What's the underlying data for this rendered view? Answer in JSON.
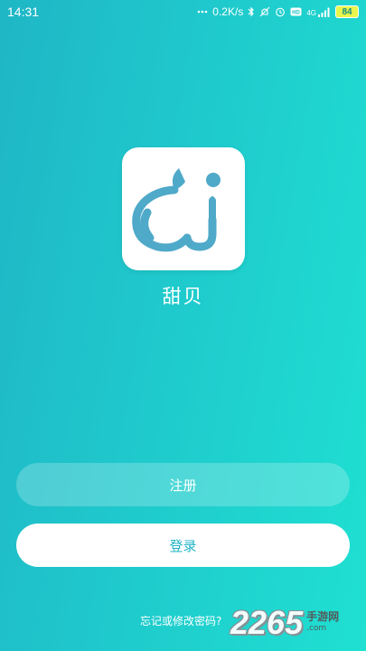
{
  "status_bar": {
    "time": "14:31",
    "network_speed": "0.2K/s",
    "network_type": "4G",
    "battery": "84",
    "icons": [
      "dots-icon",
      "bluetooth-icon",
      "mute-icon",
      "alarm-icon",
      "hd-icon",
      "signal-icon",
      "battery-icon"
    ]
  },
  "app": {
    "name": "甜贝",
    "logo_icon": "ai-speech-logo-icon",
    "accent_color": "#4fa9c9"
  },
  "buttons": {
    "register_label": "注册",
    "login_label": "登录"
  },
  "links": {
    "forgot_label": "忘记或修改密码?"
  },
  "watermark": {
    "number": "2265",
    "line1": "手游网",
    "line2": ".com"
  },
  "colors": {
    "gradient_start": "#1fb6c6",
    "gradient_end": "#1fe0d2",
    "login_text": "#1fb3c6"
  }
}
